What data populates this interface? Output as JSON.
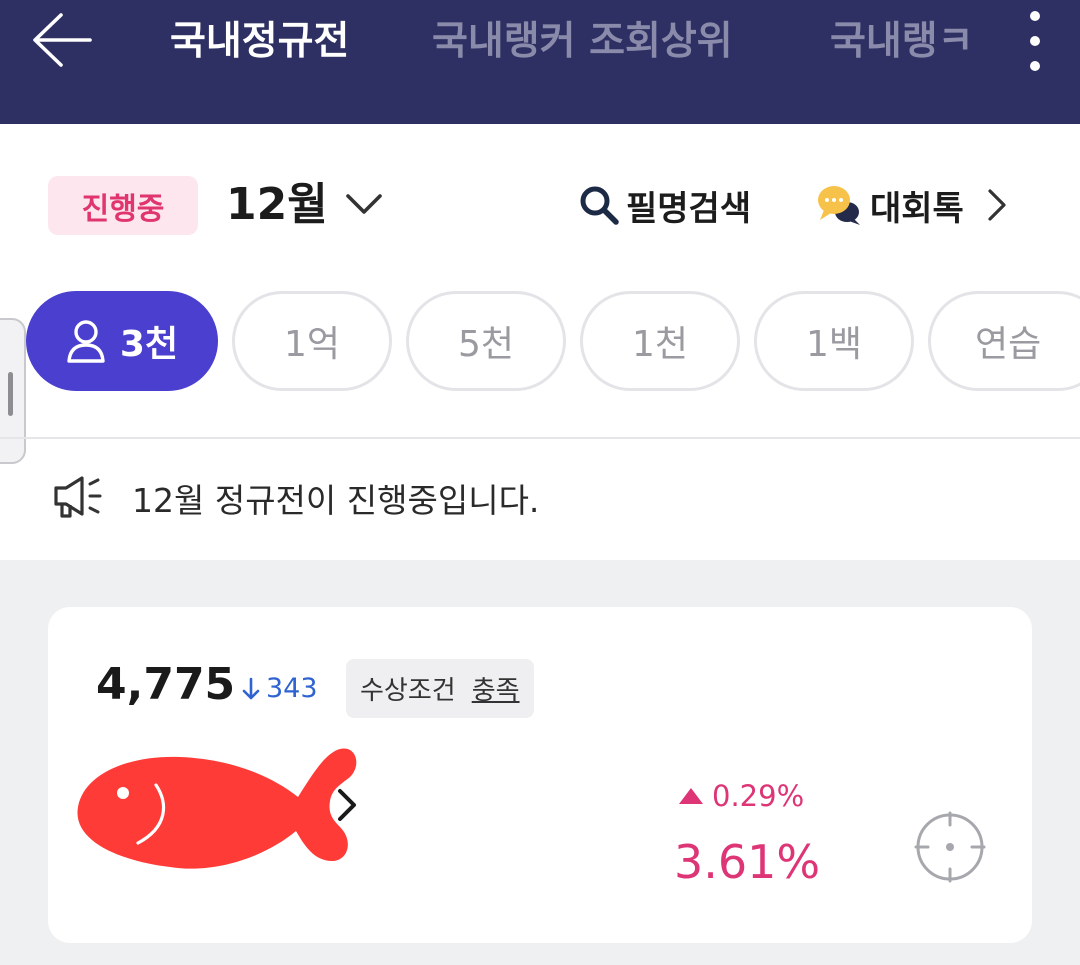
{
  "header": {
    "tabs": [
      {
        "label": "국내정규전",
        "active": true
      },
      {
        "label": "국내랭커 조회상위",
        "active": false
      },
      {
        "label": "국내랭ㅋ",
        "active": false
      }
    ],
    "icons": [
      "back-arrow-icon",
      "more-vertical-icon"
    ],
    "background": "#2e2f62"
  },
  "filter_bar": {
    "status": "진행중",
    "month": "12월",
    "search_label": "필명검색",
    "talk_label": "대회톡"
  },
  "chips": [
    {
      "label": "3천",
      "active": true,
      "icon": "person-icon"
    },
    {
      "label": "1억",
      "active": false
    },
    {
      "label": "5천",
      "active": false
    },
    {
      "label": "1천",
      "active": false
    },
    {
      "label": "1백",
      "active": false
    },
    {
      "label": "연습",
      "active": false
    }
  ],
  "notice": {
    "text": "12월 정규전이 진행중입니다.",
    "icon": "megaphone-icon"
  },
  "card": {
    "points": "4,775",
    "rank_change": "343",
    "rank_direction": "down",
    "award_label": "수상조건",
    "award_status": "충족",
    "change_pct": "0.29%",
    "change_direction": "up",
    "return_pct": "3.61%",
    "avatar_icon": "fish-icon",
    "colors": {
      "up": "#dd3575",
      "down": "#2f63d1",
      "fish": "#ff3b37"
    }
  },
  "colors": {
    "accent": "#4a3fce",
    "status_bg": "#fde6ee",
    "status_text": "#e0356f"
  }
}
